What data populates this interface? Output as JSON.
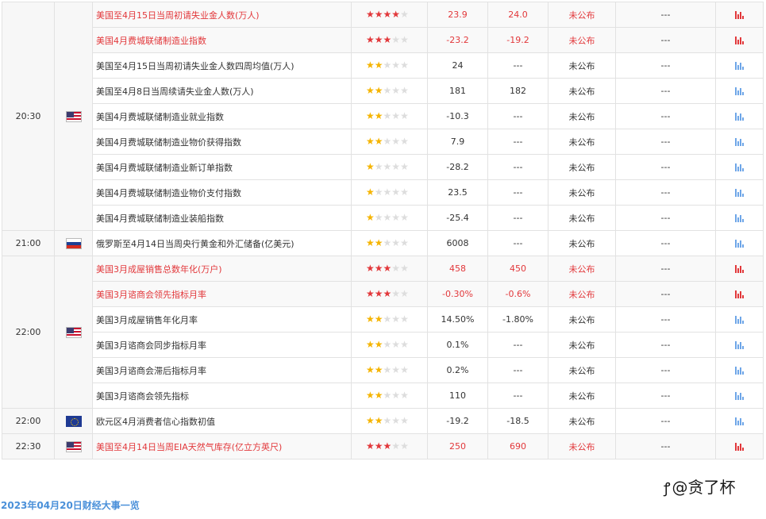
{
  "colors": {
    "highlight": "#e2383b",
    "star_gold": "#f5b400",
    "link": "#4a90d9",
    "border": "#e2e2e2"
  },
  "groups": [
    {
      "time": "20:30",
      "flag": "us",
      "rows": [
        {
          "event": "美国至4月15日当周初请失业金人数(万人)",
          "stars": 4,
          "previous": "23.9",
          "forecast": "24.0",
          "actual": "未公布",
          "impact": "---",
          "highlight": true
        },
        {
          "event": "美国4月费城联储制造业指数",
          "stars": 3,
          "previous": "-23.2",
          "forecast": "-19.2",
          "actual": "未公布",
          "impact": "---",
          "highlight": true
        },
        {
          "event": "美国至4月15日当周初请失业金人数四周均值(万人)",
          "stars": 2,
          "previous": "24",
          "forecast": "---",
          "actual": "未公布",
          "impact": "---",
          "highlight": false
        },
        {
          "event": "美国至4月8日当周续请失业金人数(万人)",
          "stars": 2,
          "previous": "181",
          "forecast": "182",
          "actual": "未公布",
          "impact": "---",
          "highlight": false
        },
        {
          "event": "美国4月费城联储制造业就业指数",
          "stars": 2,
          "previous": "-10.3",
          "forecast": "---",
          "actual": "未公布",
          "impact": "---",
          "highlight": false
        },
        {
          "event": "美国4月费城联储制造业物价获得指数",
          "stars": 2,
          "previous": "7.9",
          "forecast": "---",
          "actual": "未公布",
          "impact": "---",
          "highlight": false
        },
        {
          "event": "美国4月费城联储制造业新订单指数",
          "stars": 1,
          "previous": "-28.2",
          "forecast": "---",
          "actual": "未公布",
          "impact": "---",
          "highlight": false
        },
        {
          "event": "美国4月费城联储制造业物价支付指数",
          "stars": 1,
          "previous": "23.5",
          "forecast": "---",
          "actual": "未公布",
          "impact": "---",
          "highlight": false
        },
        {
          "event": "美国4月费城联储制造业装船指数",
          "stars": 1,
          "previous": "-25.4",
          "forecast": "---",
          "actual": "未公布",
          "impact": "---",
          "highlight": false
        }
      ]
    },
    {
      "time": "21:00",
      "flag": "ru",
      "rows": [
        {
          "event": "俄罗斯至4月14日当周央行黄金和外汇储备(亿美元)",
          "stars": 2,
          "previous": "6008",
          "forecast": "---",
          "actual": "未公布",
          "impact": "---",
          "highlight": false
        }
      ]
    },
    {
      "time": "22:00",
      "flag": "us",
      "rows": [
        {
          "event": "美国3月成屋销售总数年化(万户)",
          "stars": 3,
          "previous": "458",
          "forecast": "450",
          "actual": "未公布",
          "impact": "---",
          "highlight": true
        },
        {
          "event": "美国3月谘商会领先指标月率",
          "stars": 3,
          "previous": "-0.30%",
          "forecast": "-0.6%",
          "actual": "未公布",
          "impact": "---",
          "highlight": true
        },
        {
          "event": "美国3月成屋销售年化月率",
          "stars": 2,
          "previous": "14.50%",
          "forecast": "-1.80%",
          "actual": "未公布",
          "impact": "---",
          "highlight": false
        },
        {
          "event": "美国3月谘商会同步指标月率",
          "stars": 2,
          "previous": "0.1%",
          "forecast": "---",
          "actual": "未公布",
          "impact": "---",
          "highlight": false
        },
        {
          "event": "美国3月谘商会滞后指标月率",
          "stars": 2,
          "previous": "0.2%",
          "forecast": "---",
          "actual": "未公布",
          "impact": "---",
          "highlight": false
        },
        {
          "event": "美国3月谘商会领先指标",
          "stars": 2,
          "previous": "110",
          "forecast": "---",
          "actual": "未公布",
          "impact": "---",
          "highlight": false
        }
      ]
    },
    {
      "time": "22:00",
      "flag": "eu",
      "rows": [
        {
          "event": "欧元区4月消费者信心指数初值",
          "stars": 2,
          "previous": "-19.2",
          "forecast": "-18.5",
          "actual": "未公布",
          "impact": "---",
          "highlight": false
        }
      ]
    },
    {
      "time": "22:30",
      "flag": "us",
      "rows": [
        {
          "event": "美国至4月14日当周EIA天然气库存(亿立方英尺)",
          "stars": 3,
          "previous": "250",
          "forecast": "690",
          "actual": "未公布",
          "impact": "---",
          "highlight": true
        }
      ]
    }
  ],
  "footer": {
    "link_text": "2023年04月20日财经大事一览"
  },
  "watermark": {
    "text": "@贪了杯",
    "icon": "zhihu-icon"
  }
}
